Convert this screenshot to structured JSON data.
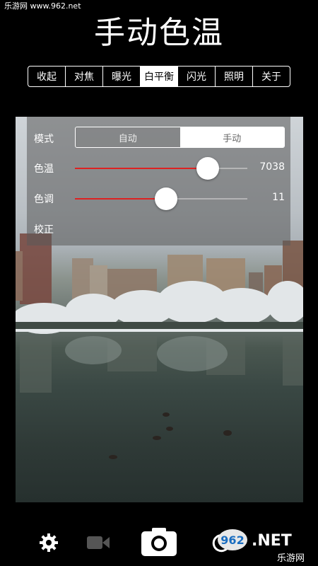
{
  "watermark_top": "乐游网 www.962.net",
  "title": "手动色温",
  "tabs": [
    {
      "label": "收起",
      "active": false
    },
    {
      "label": "对焦",
      "active": false
    },
    {
      "label": "曝光",
      "active": false
    },
    {
      "label": "白平衡",
      "active": true
    },
    {
      "label": "闪光",
      "active": false
    },
    {
      "label": "照明",
      "active": false
    },
    {
      "label": "关于",
      "active": false
    }
  ],
  "panel": {
    "mode_label": "模式",
    "mode_options": [
      "自动",
      "手动"
    ],
    "mode_selected": "手动",
    "temp_label": "色温",
    "temp_value": "7038",
    "temp_level": 0.77,
    "tint_label": "色调",
    "tint_value": "11",
    "tint_level": 0.53,
    "calib_label": "校正"
  },
  "bottom_icons": [
    "gear-icon",
    "video-camera-icon",
    "camera-shutter-icon",
    "rotate-icon"
  ],
  "watermark_logo": {
    "number": "962",
    "suffix": ".NET",
    "caption": "乐游网"
  },
  "colors": {
    "slider_fill": "#dd2222",
    "active_tab_bg": "#ffffff",
    "background": "#000000"
  }
}
